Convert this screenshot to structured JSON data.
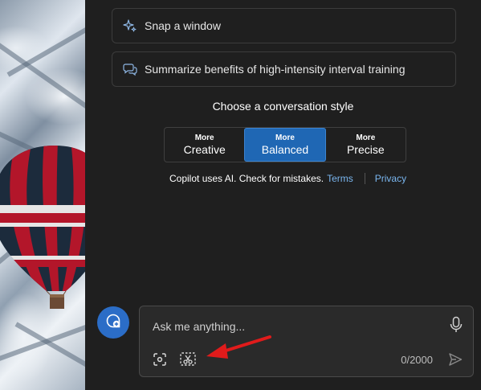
{
  "suggestions": [
    {
      "label": "Snap a window",
      "icon": "sparkle-icon"
    },
    {
      "label": "Summarize benefits of high-intensity interval training",
      "icon": "chat-bubbles-icon"
    }
  ],
  "conversation_style": {
    "title": "Choose a conversation style",
    "options": [
      {
        "small": "More",
        "label": "Creative",
        "active": false
      },
      {
        "small": "More",
        "label": "Balanced",
        "active": true
      },
      {
        "small": "More",
        "label": "Precise",
        "active": false
      }
    ]
  },
  "disclaimer": {
    "text": "Copilot uses AI. Check for mistakes.",
    "terms": "Terms",
    "privacy": "Privacy"
  },
  "input": {
    "placeholder": "Ask me anything...",
    "counter": "0/2000"
  },
  "colors": {
    "background": "#1f1f1f",
    "accent": "#1f67b4",
    "link": "#7ab6ef",
    "annotation_arrow": "#e01b1b"
  }
}
